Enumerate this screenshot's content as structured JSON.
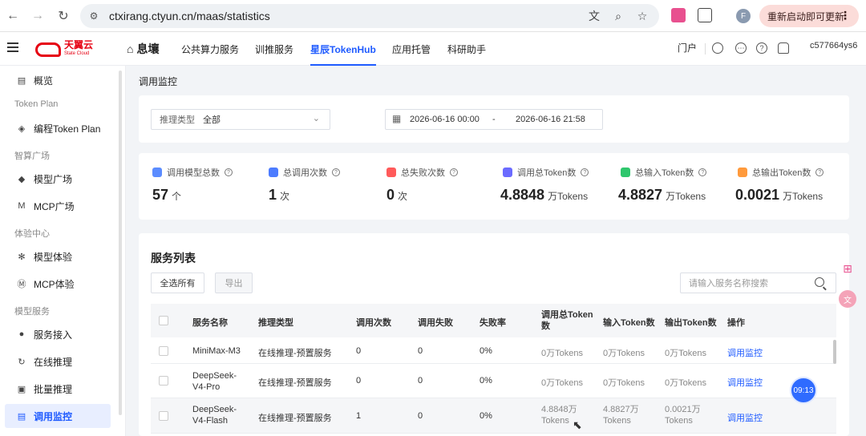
{
  "browser": {
    "url": "ctxirang.ctyun.cn/maas/statistics",
    "restart_label": "重新启动即可更新",
    "profile_letter": "F"
  },
  "header": {
    "logo_text": "天翼云",
    "logo_sub": "State Cloud",
    "nav": [
      "息壤",
      "公共算力服务",
      "训推服务",
      "星辰TokenHub",
      "应用托管",
      "科研助手"
    ],
    "portal": "门户",
    "user": "c577664ys6"
  },
  "sidebar": {
    "items": [
      {
        "label": "概览",
        "icon": "chart-icon"
      },
      {
        "group": "Token Plan"
      },
      {
        "label": "编程Token Plan",
        "icon": "token-icon"
      },
      {
        "group": "智算广场"
      },
      {
        "label": "模型广场",
        "icon": "cube-icon"
      },
      {
        "label": "MCP广场",
        "icon": "mcp-icon"
      },
      {
        "group": "体验中心"
      },
      {
        "label": "模型体验",
        "icon": "spark-icon"
      },
      {
        "label": "MCP体验",
        "icon": "mcp-circle-icon"
      },
      {
        "group": "模型服务"
      },
      {
        "label": "服务接入",
        "icon": "plug-icon"
      },
      {
        "label": "在线推理",
        "icon": "refresh-icon"
      },
      {
        "label": "批量推理",
        "icon": "batch-icon"
      },
      {
        "label": "调用监控",
        "icon": "monitor-icon"
      }
    ]
  },
  "page": {
    "title": "调用监控",
    "filter": {
      "label": "推理类型",
      "value": "全部"
    },
    "date": {
      "start": "2026-06-16 00:00",
      "sep": "-",
      "end": "2026-06-16 21:58"
    }
  },
  "stats": [
    {
      "label": "调用模型总数",
      "value": "57",
      "unit": "个",
      "color": "#5b8cff"
    },
    {
      "label": "总调用次数",
      "value": "1",
      "unit": "次",
      "color": "#4d7cff"
    },
    {
      "label": "总失败次数",
      "value": "0",
      "unit": "次",
      "color": "#ff5a5a"
    },
    {
      "label": "调用总Token数",
      "value": "4.8848",
      "unit": "万Tokens",
      "color": "#6b6bff"
    },
    {
      "label": "总输入Token数",
      "value": "4.8827",
      "unit": "万Tokens",
      "color": "#2fc76d"
    },
    {
      "label": "总输出Token数",
      "value": "0.0021",
      "unit": "万Tokens",
      "color": "#ff9a3c"
    }
  ],
  "services": {
    "title": "服务列表",
    "select_all": "全选所有",
    "export": "导出",
    "search_placeholder": "请输入服务名称搜索",
    "columns": [
      "服务名称",
      "推理类型",
      "调用次数",
      "调用失败",
      "失败率",
      "调用总Token数",
      "输入Token数",
      "输出Token数",
      "操作"
    ],
    "rows": [
      {
        "name": "MiniMax-M3",
        "type": "在线推理-预置服务",
        "calls": "0",
        "fails": "0",
        "rate": "0%",
        "total": "0万Tokens",
        "input": "0万Tokens",
        "output": "0万Tokens",
        "action": "调用监控"
      },
      {
        "name": "DeepSeek-V4-Pro",
        "type": "在线推理-预置服务",
        "calls": "0",
        "fails": "0",
        "rate": "0%",
        "total": "0万Tokens",
        "input": "0万Tokens",
        "output": "0万Tokens",
        "action": "调用监控"
      },
      {
        "name": "DeepSeek-V4-Flash",
        "type": "在线推理-预置服务",
        "calls": "1",
        "fails": "0",
        "rate": "0%",
        "total": "4.8848万Tokens",
        "input": "4.8827万Tokens",
        "output": "0.0021万Tokens",
        "action": "调用监控"
      }
    ]
  },
  "clock": "09:13"
}
